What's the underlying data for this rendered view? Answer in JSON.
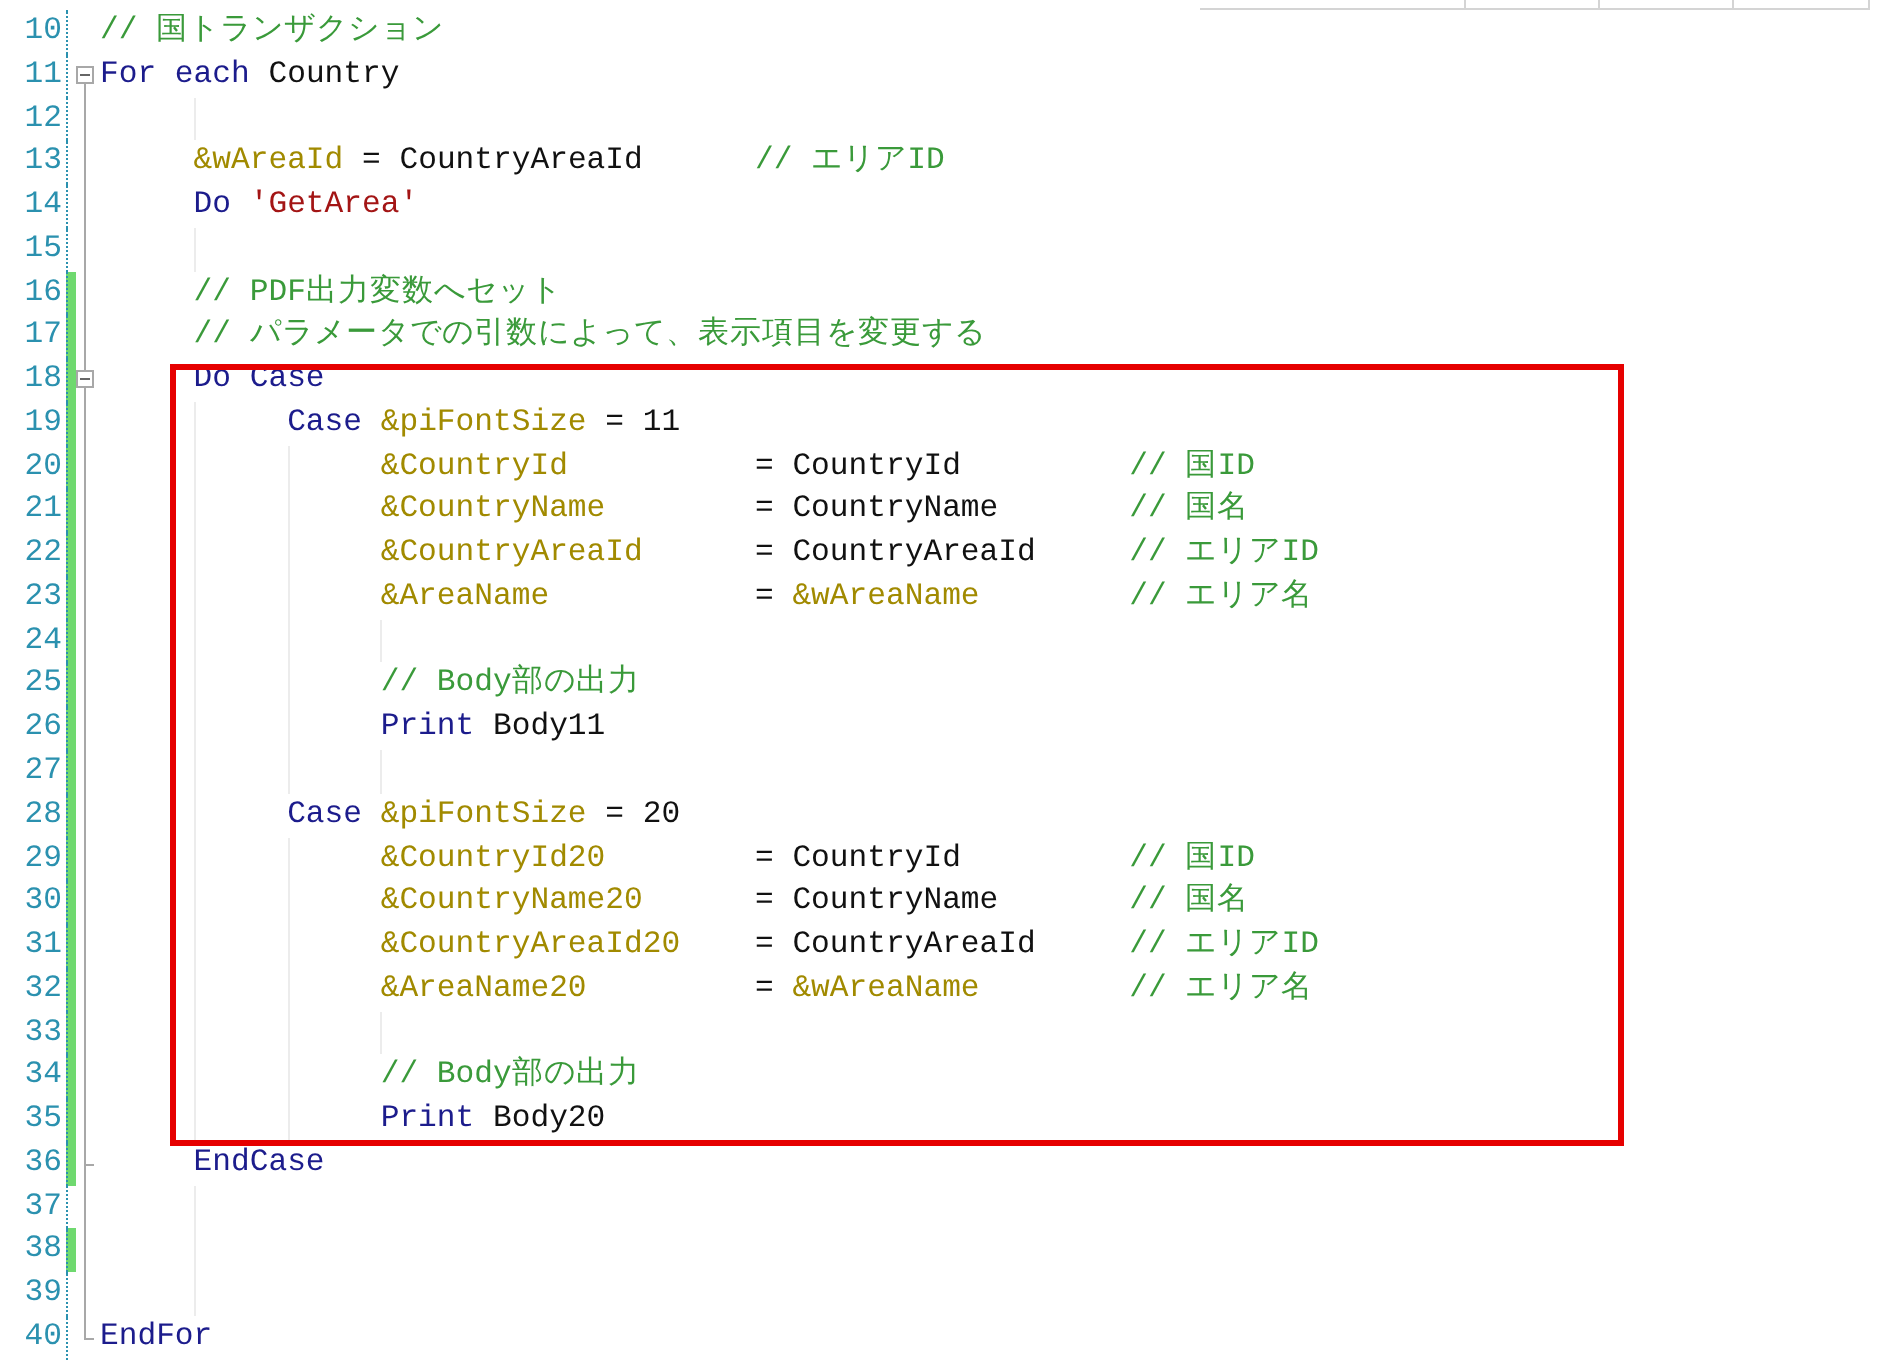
{
  "lines": [
    {
      "number": "10",
      "changed": false,
      "kind": "tokens",
      "tokens": [
        {
          "kind": "comment",
          "text": "// 国トランザクション"
        }
      ]
    },
    {
      "number": "11",
      "changed": false,
      "collapsible": true,
      "kind": "tokens",
      "tokens": [
        {
          "kind": "keyword",
          "text": "For each"
        },
        {
          "kind": "plain",
          "text": "Country"
        }
      ],
      "children": [
        {
          "number": "12",
          "changed": false,
          "kind": "blank"
        },
        {
          "number": "13",
          "changed": false,
          "kind": "assign",
          "aligned": false,
          "target": "&wAreaId",
          "operator": "=",
          "value": {
            "kind": "plain",
            "text": "CountryAreaId"
          },
          "comment": "// エリアID"
        },
        {
          "number": "14",
          "changed": false,
          "kind": "tokens",
          "tokens": [
            {
              "kind": "keyword",
              "text": "Do"
            },
            {
              "kind": "string",
              "text": "'GetArea'"
            }
          ]
        },
        {
          "number": "15",
          "changed": false,
          "kind": "blank"
        },
        {
          "number": "16",
          "changed": true,
          "kind": "tokens",
          "tokens": [
            {
              "kind": "comment",
              "text": "// PDF出力変数へセット"
            }
          ]
        },
        {
          "number": "17",
          "changed": true,
          "kind": "tokens",
          "tokens": [
            {
              "kind": "comment",
              "text": "// パラメータでの引数によって、表示項目を変更する"
            }
          ]
        },
        {
          "number": "18",
          "changed": true,
          "collapsible": true,
          "highlighted": true,
          "kind": "tokens",
          "tokens": [
            {
              "kind": "keyword",
              "text": "Do Case"
            }
          ],
          "children": [
            {
              "number": "19",
              "changed": true,
              "kind": "tokens",
              "tokens": [
                {
                  "kind": "keyword",
                  "text": "Case"
                },
                {
                  "kind": "variable",
                  "text": "&piFontSize"
                },
                {
                  "kind": "plain",
                  "text": "= 11"
                }
              ],
              "children": [
                {
                  "number": "20",
                  "changed": true,
                  "kind": "assign",
                  "aligned": true,
                  "target": "&CountryId",
                  "operator": "=",
                  "value": {
                    "kind": "plain",
                    "text": "CountryId"
                  },
                  "comment": "// 国ID"
                },
                {
                  "number": "21",
                  "changed": true,
                  "kind": "assign",
                  "aligned": true,
                  "target": "&CountryName",
                  "operator": "=",
                  "value": {
                    "kind": "plain",
                    "text": "CountryName"
                  },
                  "comment": "// 国名"
                },
                {
                  "number": "22",
                  "changed": true,
                  "kind": "assign",
                  "aligned": true,
                  "target": "&CountryAreaId",
                  "operator": "=",
                  "value": {
                    "kind": "plain",
                    "text": "CountryAreaId"
                  },
                  "comment": "// エリアID"
                },
                {
                  "number": "23",
                  "changed": true,
                  "kind": "assign",
                  "aligned": true,
                  "target": "&AreaName",
                  "operator": "=",
                  "value": {
                    "kind": "variable",
                    "text": "&wAreaName"
                  },
                  "comment": "// エリア名"
                },
                {
                  "number": "24",
                  "changed": true,
                  "kind": "blank"
                },
                {
                  "number": "25",
                  "changed": true,
                  "kind": "tokens",
                  "tokens": [
                    {
                      "kind": "comment",
                      "text": "// Body部の出力"
                    }
                  ]
                },
                {
                  "number": "26",
                  "changed": true,
                  "kind": "tokens",
                  "tokens": [
                    {
                      "kind": "keyword",
                      "text": "Print"
                    },
                    {
                      "kind": "plain",
                      "text": "Body11"
                    }
                  ]
                },
                {
                  "number": "27",
                  "changed": true,
                  "kind": "blank"
                }
              ]
            },
            {
              "number": "28",
              "changed": true,
              "kind": "tokens",
              "tokens": [
                {
                  "kind": "keyword",
                  "text": "Case"
                },
                {
                  "kind": "variable",
                  "text": "&piFontSize"
                },
                {
                  "kind": "plain",
                  "text": "= 20"
                }
              ],
              "children": [
                {
                  "number": "29",
                  "changed": true,
                  "kind": "assign",
                  "aligned": true,
                  "target": "&CountryId20",
                  "operator": "=",
                  "value": {
                    "kind": "plain",
                    "text": "CountryId"
                  },
                  "comment": "// 国ID"
                },
                {
                  "number": "30",
                  "changed": true,
                  "kind": "assign",
                  "aligned": true,
                  "target": "&CountryName20",
                  "operator": "=",
                  "value": {
                    "kind": "plain",
                    "text": "CountryName"
                  },
                  "comment": "// 国名"
                },
                {
                  "number": "31",
                  "changed": true,
                  "kind": "assign",
                  "aligned": true,
                  "target": "&CountryAreaId20",
                  "operator": "=",
                  "value": {
                    "kind": "plain",
                    "text": "CountryAreaId"
                  },
                  "comment": "// エリアID"
                },
                {
                  "number": "32",
                  "changed": true,
                  "kind": "assign",
                  "aligned": true,
                  "target": "&AreaName20",
                  "operator": "=",
                  "value": {
                    "kind": "variable",
                    "text": "&wAreaName"
                  },
                  "comment": "// エリア名"
                },
                {
                  "number": "33",
                  "changed": true,
                  "kind": "blank"
                },
                {
                  "number": "34",
                  "changed": true,
                  "kind": "tokens",
                  "tokens": [
                    {
                      "kind": "comment",
                      "text": "// Body部の出力"
                    }
                  ]
                },
                {
                  "number": "35",
                  "changed": true,
                  "kind": "tokens",
                  "tokens": [
                    {
                      "kind": "keyword",
                      "text": "Print"
                    },
                    {
                      "kind": "plain",
                      "text": "Body20"
                    }
                  ]
                }
              ]
            }
          ]
        },
        {
          "number": "36",
          "changed": true,
          "kind": "block-end",
          "tokens": [
            {
              "kind": "keyword",
              "text": "EndCase"
            }
          ]
        },
        {
          "number": "37",
          "changed": false,
          "kind": "blank"
        },
        {
          "number": "38",
          "changed": true,
          "kind": "blank"
        },
        {
          "number": "39",
          "changed": false,
          "kind": "blank"
        }
      ]
    },
    {
      "number": "40",
      "changed": false,
      "kind": "block-end",
      "tokens": [
        {
          "kind": "keyword",
          "text": "EndFor"
        }
      ]
    }
  ]
}
